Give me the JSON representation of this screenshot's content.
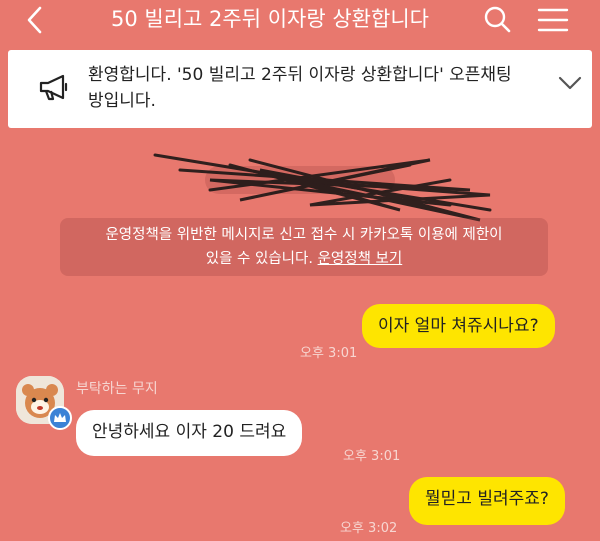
{
  "header": {
    "title": "50 빌리고 2주뒤 이자랑 상환합니다"
  },
  "notice": {
    "text": "환영합니다. '50 빌리고 2주뒤 이자랑 상환합니다' 오픈채팅방입니다."
  },
  "policy": {
    "line1": "운영정책을 위반한 메시지로 신고 접수 시 카카오톡 이용에 제한이",
    "line2": "있을 수 있습니다.",
    "link": "운영정책 보기"
  },
  "messages": [
    {
      "from": "me",
      "text": "이자 얼마 쳐쥬시나요?",
      "time": "오후 3:01"
    },
    {
      "from": "other",
      "sender": "부탁하는 무지",
      "text": "안녕하세요 이자 20 드려요",
      "time": "오후 3:01"
    },
    {
      "from": "me",
      "text": "뭘믿고 빌려주죠?",
      "time": "오후 3:02"
    }
  ],
  "colors": {
    "background": "#e8786e",
    "my_bubble": "#fee500",
    "other_bubble": "#ffffff"
  },
  "icons": [
    "back-arrow-icon",
    "search-icon",
    "menu-icon",
    "megaphone-icon",
    "chevron-down-icon"
  ]
}
